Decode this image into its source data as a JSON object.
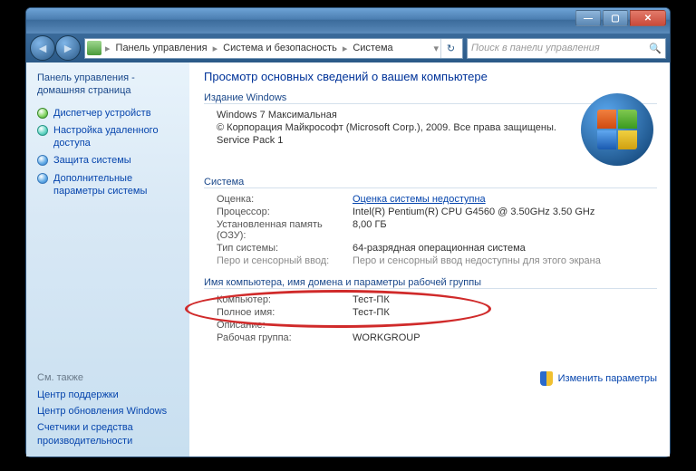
{
  "titlebar": {
    "min": "—",
    "max": "▢",
    "close": "✕"
  },
  "nav": {
    "back": "◄",
    "fwd": "►",
    "refresh": "↻",
    "dropdown": "▾",
    "seg1": "Панель управления",
    "seg2": "Система и безопасность",
    "seg3": "Система",
    "search_placeholder": "Поиск в панели управления",
    "search_icon": "🔍"
  },
  "sidebar": {
    "home": "Панель управления - домашняя страница",
    "items": [
      "Диспетчер устройств",
      "Настройка удаленного доступа",
      "Защита системы",
      "Дополнительные параметры системы"
    ],
    "seealso_hdr": "См. также",
    "seealso": [
      "Центр поддержки",
      "Центр обновления Windows",
      "Счетчики и средства производительности"
    ]
  },
  "main": {
    "title": "Просмотр основных сведений о вашем компьютере",
    "section1": "Издание Windows",
    "edition": "Windows 7 Максимальная",
    "copyright": "© Корпорация Майкрософт (Microsoft Corp.), 2009. Все права защищены.",
    "sp": "Service Pack 1",
    "section2": "Система",
    "row_rating_k": "Оценка:",
    "row_rating_v": "Оценка системы недоступна",
    "row_cpu_k": "Процессор:",
    "row_cpu_v": "Intel(R) Pentium(R) CPU G4560 @ 3.50GHz   3.50 GHz",
    "row_ram_k": "Установленная память (ОЗУ):",
    "row_ram_v": "8,00 ГБ",
    "row_type_k": "Тип системы:",
    "row_type_v": "64-разрядная операционная система",
    "row_pen_k": "Перо и сенсорный ввод:",
    "row_pen_v": "Перо и сенсорный ввод недоступны для этого экрана",
    "section3": "Имя компьютера, имя домена и параметры рабочей группы",
    "row_pc_k": "Компьютер:",
    "row_pc_v": "Тест-ПК",
    "row_full_k": "Полное имя:",
    "row_full_v": "Тест-ПК",
    "row_desc_k": "Описание:",
    "row_desc_v": "",
    "row_wg_k": "Рабочая группа:",
    "row_wg_v": "WORKGROUP",
    "change_params": "Изменить параметры",
    "help": "?"
  }
}
